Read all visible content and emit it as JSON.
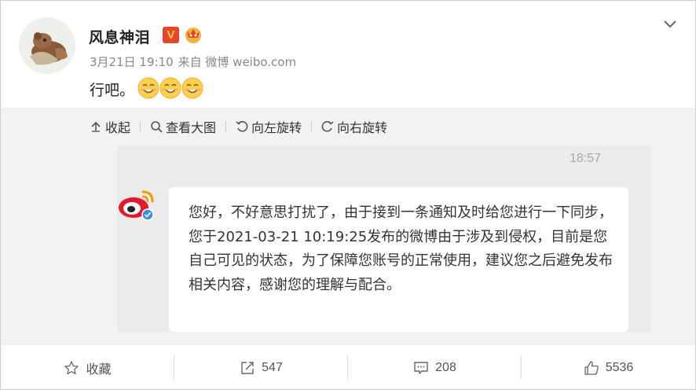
{
  "post": {
    "username": "风息神泪",
    "vip_badge": "V",
    "date": "3月21日 19:10",
    "source": "来自 微博 weibo.com",
    "text": "行吧。",
    "emoji_icon": "smile-emoji"
  },
  "media_toolbar": {
    "collapse": "收起",
    "view_large": "查看大图",
    "rotate_left": "向左旋转",
    "rotate_right": "向右旋转"
  },
  "chat": {
    "time": "18:57",
    "message": "您好，不好意思打扰了，由于接到一条通知及时给您进行一下同步，您于2021-03-21 10:19:25发布的微博由于涉及到侵权，目前是您自己可见的状态，为了保障您账号的正常使用，建议您之后避免发布相关内容，感谢您的理解与配合。"
  },
  "footer": {
    "favorite": "收藏",
    "repost_count": "547",
    "comment_count": "208",
    "like_count": "5536"
  },
  "colors": {
    "vip_red": "#e8442a",
    "weibo_red": "#e6162d",
    "verified_blue": "#3c8fe0",
    "text_gray": "#888888"
  }
}
